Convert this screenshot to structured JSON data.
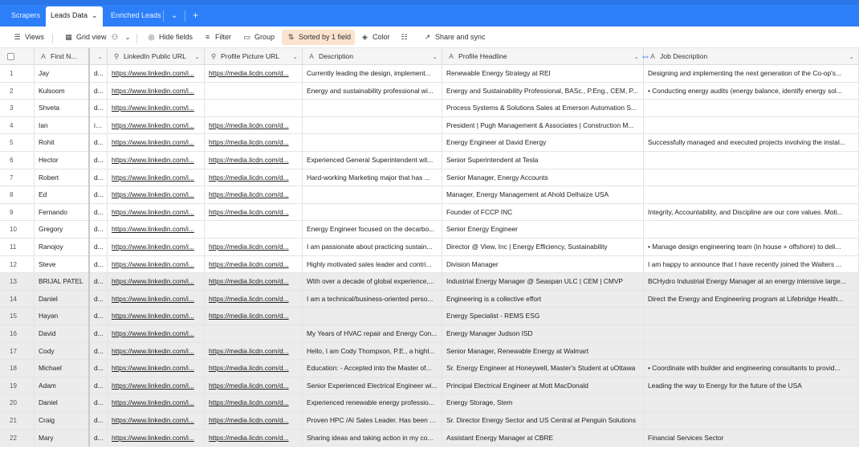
{
  "tabs": {
    "items": [
      {
        "label": "Scrapers"
      },
      {
        "label": "Leads Data",
        "active": true
      },
      {
        "label": "Enriched Leads"
      }
    ],
    "more_icon": "chevron-down-icon",
    "add_icon": "plus-icon"
  },
  "toolbar": {
    "views_label": "Views",
    "grid_view_label": "Grid view",
    "hide_fields_label": "Hide fields",
    "filter_label": "Filter",
    "group_label": "Group",
    "sorted_label": "Sorted by 1 field",
    "color_label": "Color",
    "share_label": "Share and sync"
  },
  "columns": [
    {
      "label": "First N...",
      "icon": "A"
    },
    {
      "label": "",
      "icon": "chevron-down"
    },
    {
      "label": "LinkedIn Public URL",
      "icon": "link"
    },
    {
      "label": "Profile Picture URL",
      "icon": "link"
    },
    {
      "label": "Description",
      "icon": "A"
    },
    {
      "label": "Profile Headline",
      "icon": "A"
    },
    {
      "label": "Job Description",
      "icon": "A"
    }
  ],
  "rows": [
    {
      "n": "1",
      "first": "Jay",
      "c2": "d...",
      "li": "https://www.linkedin.com/i...",
      "pic": "https://media.licdn.com/d...",
      "desc": "Currently leading the design, implement...",
      "head": "Renewable Energy Strategy at REI",
      "job": "Designing and implementing the next generation of the Co-op's..."
    },
    {
      "n": "2",
      "first": "Kulsoom",
      "c2": "d...",
      "li": "https://www.linkedin.com/i...",
      "pic": "",
      "desc": "Energy and sustainability professional wi...",
      "head": "Energy and Sustainability Professional, BASc., P.Eng., CEM, P...",
      "job": "• Conducting energy audits (energy balance, identify energy sol..."
    },
    {
      "n": "3",
      "first": "Shveta",
      "c2": "d...",
      "li": "https://www.linkedin.com/i...",
      "pic": "",
      "desc": "",
      "head": "Process Systems & Solutions Sales at Emerson Automation S...",
      "job": ""
    },
    {
      "n": "4",
      "first": "Ian",
      "c2": "ic...",
      "li": "https://www.linkedin.com/i...",
      "pic": "https://media.licdn.com/d...",
      "desc": "",
      "head": "President | Pugh Management & Associates | Construction M...",
      "job": ""
    },
    {
      "n": "5",
      "first": "Rohit",
      "c2": "d...",
      "li": "https://www.linkedin.com/i...",
      "pic": "https://media.licdn.com/d...",
      "desc": "",
      "head": "Energy Engineer at David Energy",
      "job": "Successfully managed and executed projects involving the instal..."
    },
    {
      "n": "6",
      "first": "Hector",
      "c2": "d...",
      "li": "https://www.linkedin.com/i...",
      "pic": "https://media.licdn.com/d...",
      "desc": "Experienced General Superintendent wit...",
      "head": "Senior Superintendent at Tesla",
      "job": ""
    },
    {
      "n": "7",
      "first": "Robert",
      "c2": "d...",
      "li": "https://www.linkedin.com/i...",
      "pic": "https://media.licdn.com/d...",
      "desc": "Hard-working Marketing major that has ...",
      "head": "Senior Manager, Energy Accounts",
      "job": ""
    },
    {
      "n": "8",
      "first": "Ed",
      "c2": "d...",
      "li": "https://www.linkedin.com/i...",
      "pic": "https://media.licdn.com/d...",
      "desc": "",
      "head": "Manager, Energy Management at Ahold Delhaize USA",
      "job": ""
    },
    {
      "n": "9",
      "first": "Fernando",
      "c2": "d...",
      "li": "https://www.linkedin.com/i...",
      "pic": "https://media.licdn.com/d...",
      "desc": "",
      "head": "Founder of FCCP INC",
      "job": "Integrity, Accountability, and Discipline are our core values. Moti..."
    },
    {
      "n": "10",
      "first": "Gregory",
      "c2": "d...",
      "li": "https://www.linkedin.com/i...",
      "pic": "",
      "desc": "Energy Engineer focused on the decarbo...",
      "head": "Senior Energy Engineer",
      "job": ""
    },
    {
      "n": "11",
      "first": "Ranojoy",
      "c2": "d...",
      "li": "https://www.linkedin.com/i...",
      "pic": "https://media.licdn.com/d...",
      "desc": "I am passionate about practicing sustain...",
      "head": "Director @ View, Inc | Energy Efficiency, Sustainability",
      "job": "• Manage design engineering team (in house + offshore) to deli..."
    },
    {
      "n": "12",
      "first": "Steve",
      "c2": "d...",
      "li": "https://www.linkedin.com/i...",
      "pic": "https://media.licdn.com/d...",
      "desc": "Highly motivated sales leader and contri...",
      "head": "Division Manager",
      "job": "I am happy to announce that I have recently joined the Walters ..."
    },
    {
      "n": "13",
      "first": "BRIJAL PATEL",
      "c2": "d...",
      "li": "https://www.linkedin.com/i...",
      "pic": "https://media.licdn.com/d...",
      "desc": "With over a decade of global experience,...",
      "head": "Industrial Energy Manager @ Seaspan ULC | CEM | CMVP",
      "job": "BCHydro Industrial Energy Manager at an energy intensive large..."
    },
    {
      "n": "14",
      "first": "Daniel",
      "c2": "d...",
      "li": "https://www.linkedin.com/i...",
      "pic": "https://media.licdn.com/d...",
      "desc": "I am a technical/business-oriented perso...",
      "head": "Engineering is a collective effort",
      "job": "Direct the Energy and Engineering program at Lifebridge Health..."
    },
    {
      "n": "15",
      "first": "Hayan",
      "c2": "d...",
      "li": "https://www.linkedin.com/i...",
      "pic": "https://media.licdn.com/d...",
      "desc": "",
      "head": "Energy Specialist - REMS ESG",
      "job": ""
    },
    {
      "n": "16",
      "first": "David",
      "c2": "d...",
      "li": "https://www.linkedin.com/i...",
      "pic": "",
      "desc": "My Years of HVAC repair and Energy Con...",
      "head": "Energy Manager Judson ISD",
      "job": ""
    },
    {
      "n": "17",
      "first": "Cody",
      "c2": "d...",
      "li": "https://www.linkedin.com/i...",
      "pic": "https://media.licdn.com/d...",
      "desc": "Hello, I am Cody Thompson, P.E., a highl...",
      "head": "Senior Manager, Renewable Energy at Walmart",
      "job": ""
    },
    {
      "n": "18",
      "first": "Michael",
      "c2": "d...",
      "li": "https://www.linkedin.com/i...",
      "pic": "https://media.licdn.com/d...",
      "desc": "Education: - Accepted into the Master of...",
      "head": "Sr. Energy Engineer at Honeywell, Master's Student at uOttawa",
      "job": "• Coordinate with builder and engineering consultants to provid..."
    },
    {
      "n": "19",
      "first": "Adam",
      "c2": "d...",
      "li": "https://www.linkedin.com/i...",
      "pic": "https://media.licdn.com/d...",
      "desc": "Senior Experienced Electrical Engineer wi...",
      "head": "Principal Electrical Engineer at Mott MacDonald",
      "job": "Leading the way to Energy for the future of the USA"
    },
    {
      "n": "20",
      "first": "Daniel",
      "c2": "d...",
      "li": "https://www.linkedin.com/i...",
      "pic": "https://media.licdn.com/d...",
      "desc": "Experienced renewable energy professio...",
      "head": "Energy Storage, Stem",
      "job": ""
    },
    {
      "n": "21",
      "first": "Craig",
      "c2": "d...",
      "li": "https://www.linkedin.com/i...",
      "pic": "https://media.licdn.com/d...",
      "desc": "Proven HPC /AI Sales Leader. Has been a...",
      "head": "Sr. Director Energy Sector and US Central at Penguin Solutions",
      "job": ""
    },
    {
      "n": "22",
      "first": "Mary",
      "c2": "d...",
      "li": "https://www.linkedin.com/i...",
      "pic": "https://media.licdn.com/d...",
      "desc": "Sharing ideas and taking action in my co...",
      "head": "Assistant Energy Manager at CBRE",
      "job": "Financial Services Sector"
    }
  ]
}
